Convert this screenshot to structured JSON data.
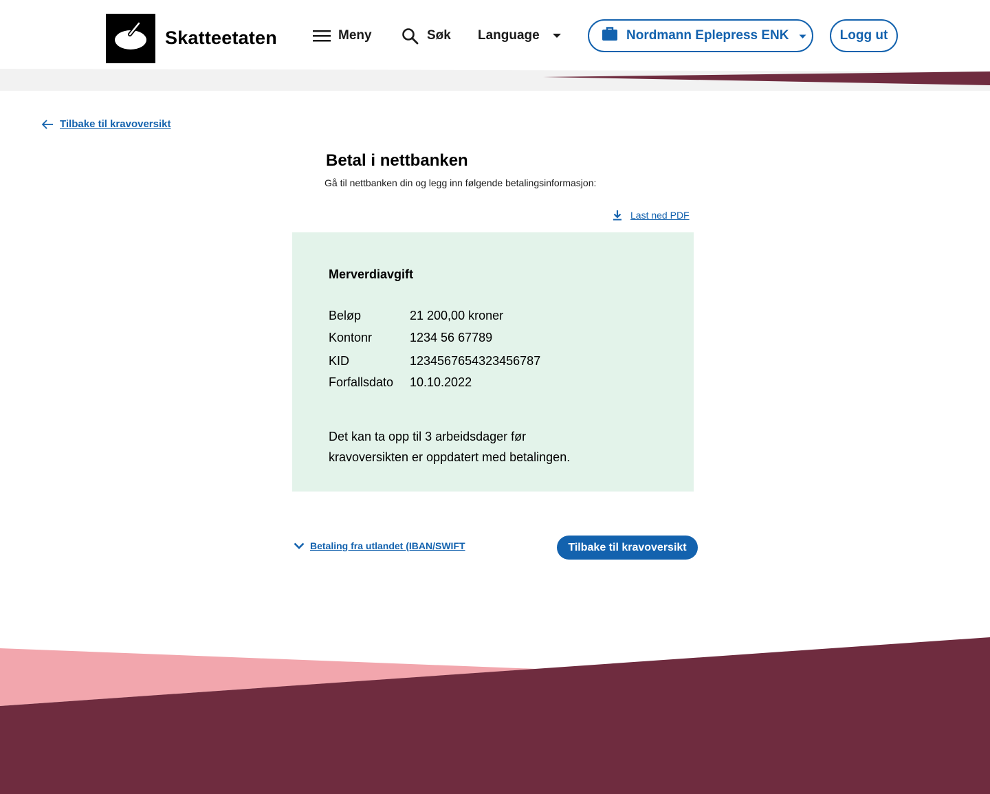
{
  "header": {
    "logo_text": "Skatteetaten",
    "menu_label": "Meny",
    "search_label": "Søk",
    "language_label": "Language",
    "organization_label": "Nordmann Eplepress ENK",
    "logout_label": "Logg ut"
  },
  "back_link": {
    "label": "Tilbake til kravoversikt"
  },
  "main": {
    "title": "Betal i nettbanken",
    "lead": "Gå til nettbanken din og legg inn følgende betalingsinformasjon:",
    "pdf_link_label": "Last ned PDF"
  },
  "payment": {
    "heading": "Merverdiavgift",
    "rows": [
      {
        "label": "Beløp",
        "value": "21 200,00 kroner"
      },
      {
        "label": "Kontonr",
        "value": "1234 56 67789"
      },
      {
        "label": "KID",
        "value": "1234567654323456787"
      },
      {
        "label": "Forfallsdato",
        "value": "10.10.2022"
      }
    ],
    "note_line1": "Det kan ta opp til 3 arbeidsdager før",
    "note_line2": "kravoversikten er oppdatert med betalingen."
  },
  "footer_actions": {
    "iban_toggle_label": "Betaling fra utlandet (IBAN/SWIFT",
    "primary_button_label": "Tilbake til kravoversikt"
  },
  "colors": {
    "accent_blue": "#1362ae",
    "info_box_bg": "#e3f3ea",
    "burgundy": "#6f2c3f",
    "pink": "#f2a6ad",
    "light_gray": "#f2f2f2"
  },
  "icons": {
    "logo": "skatteetaten-logo-icon",
    "menu": "hamburger-icon",
    "search": "search-icon",
    "language_caret": "caret-down-icon",
    "organization": "briefcase-icon",
    "back": "arrow-left-icon",
    "pdf": "download-icon",
    "iban": "chevron-down-icon"
  }
}
